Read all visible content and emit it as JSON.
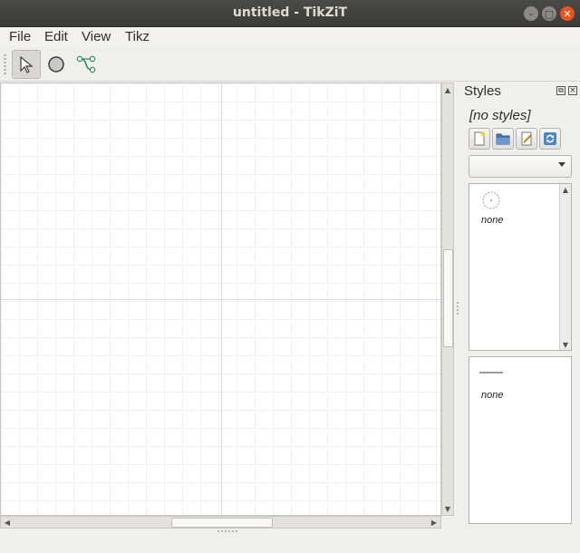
{
  "window": {
    "title": "untitled - TikZiT"
  },
  "menubar": {
    "items": [
      {
        "id": "file",
        "label": "File"
      },
      {
        "id": "edit",
        "label": "Edit"
      },
      {
        "id": "view",
        "label": "View"
      },
      {
        "id": "tikz",
        "label": "Tikz"
      }
    ]
  },
  "toolbar": {
    "tools": [
      {
        "id": "select",
        "icon": "select-arrow-icon",
        "active": true
      },
      {
        "id": "node",
        "icon": "node-circle-icon",
        "active": false
      },
      {
        "id": "edge",
        "icon": "edge-icon",
        "active": false
      }
    ]
  },
  "styles_panel": {
    "title": "Styles",
    "current_file": "[no styles]",
    "buttons": [
      "new-style-file-icon",
      "open-style-file-icon",
      "edit-styles-icon",
      "refresh-styles-icon"
    ],
    "category_selected": "",
    "node_styles": [
      {
        "label": "none"
      }
    ],
    "edge_styles": [
      {
        "label": "none"
      }
    ]
  },
  "colors": {
    "titlebar": "#3b3b38",
    "close_button": "#e95420",
    "edge_icon_color": "#2e8b57",
    "canvas_background": "#ffffff"
  }
}
